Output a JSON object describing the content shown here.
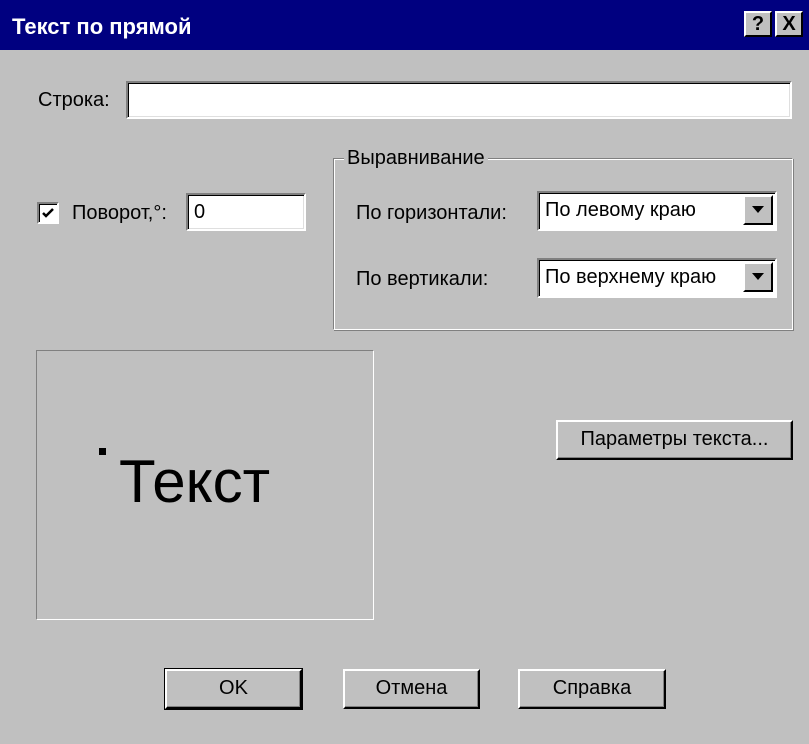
{
  "window": {
    "title": "Текст по прямой",
    "help_label": "?",
    "close_label": "X"
  },
  "string_field": {
    "label": "Строка:",
    "value": ""
  },
  "rotation": {
    "checked": true,
    "label": "Поворот,°:",
    "value": "0"
  },
  "alignment": {
    "group_title": "Выравнивание",
    "horizontal_label": "По горизонтали:",
    "horizontal_value": "По левому краю",
    "vertical_label": "По вертикали:",
    "vertical_value": "По верхнему краю"
  },
  "preview": {
    "sample_text": "Текст"
  },
  "buttons": {
    "text_params": "Параметры текста...",
    "ok": "OK",
    "cancel": "Отмена",
    "help": "Справка"
  },
  "icons": {
    "checkbox": "checkmark-icon",
    "dropdown": "chevron-down-icon"
  }
}
